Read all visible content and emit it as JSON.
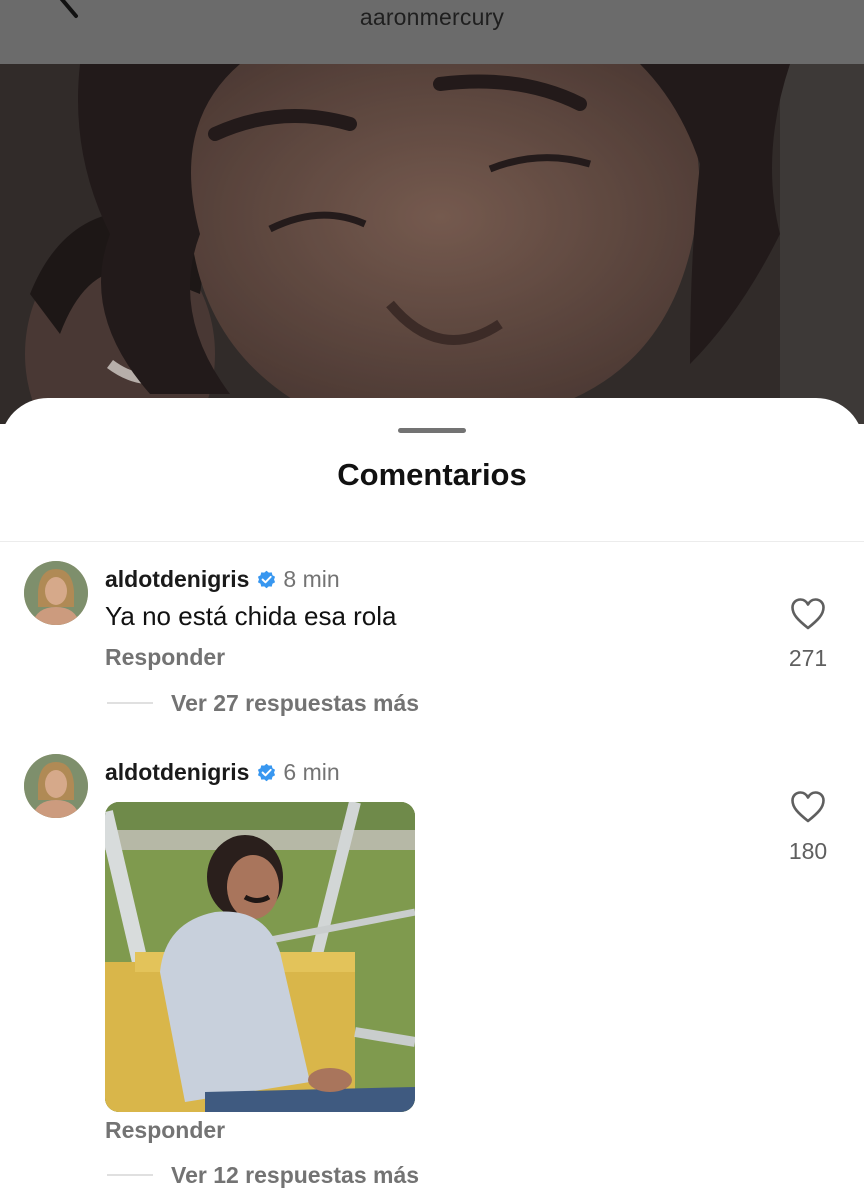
{
  "header": {
    "username": "aaronmercury"
  },
  "sheet": {
    "title": "Comentarios"
  },
  "comments": [
    {
      "user": "aldotdenigris",
      "time": "8 min",
      "text": "Ya no está chida esa rola",
      "reply_label": "Responder",
      "more_replies": "Ver 27 respuestas más",
      "likes": "271"
    },
    {
      "user": "aldotdenigris",
      "time": "6 min",
      "reply_label": "Responder",
      "more_replies": "Ver 12 respuestas más",
      "likes": "180"
    }
  ],
  "colors": {
    "verified": "#3897f0",
    "secondary_text": "#737373",
    "header_bg": "#6b6b6b"
  }
}
